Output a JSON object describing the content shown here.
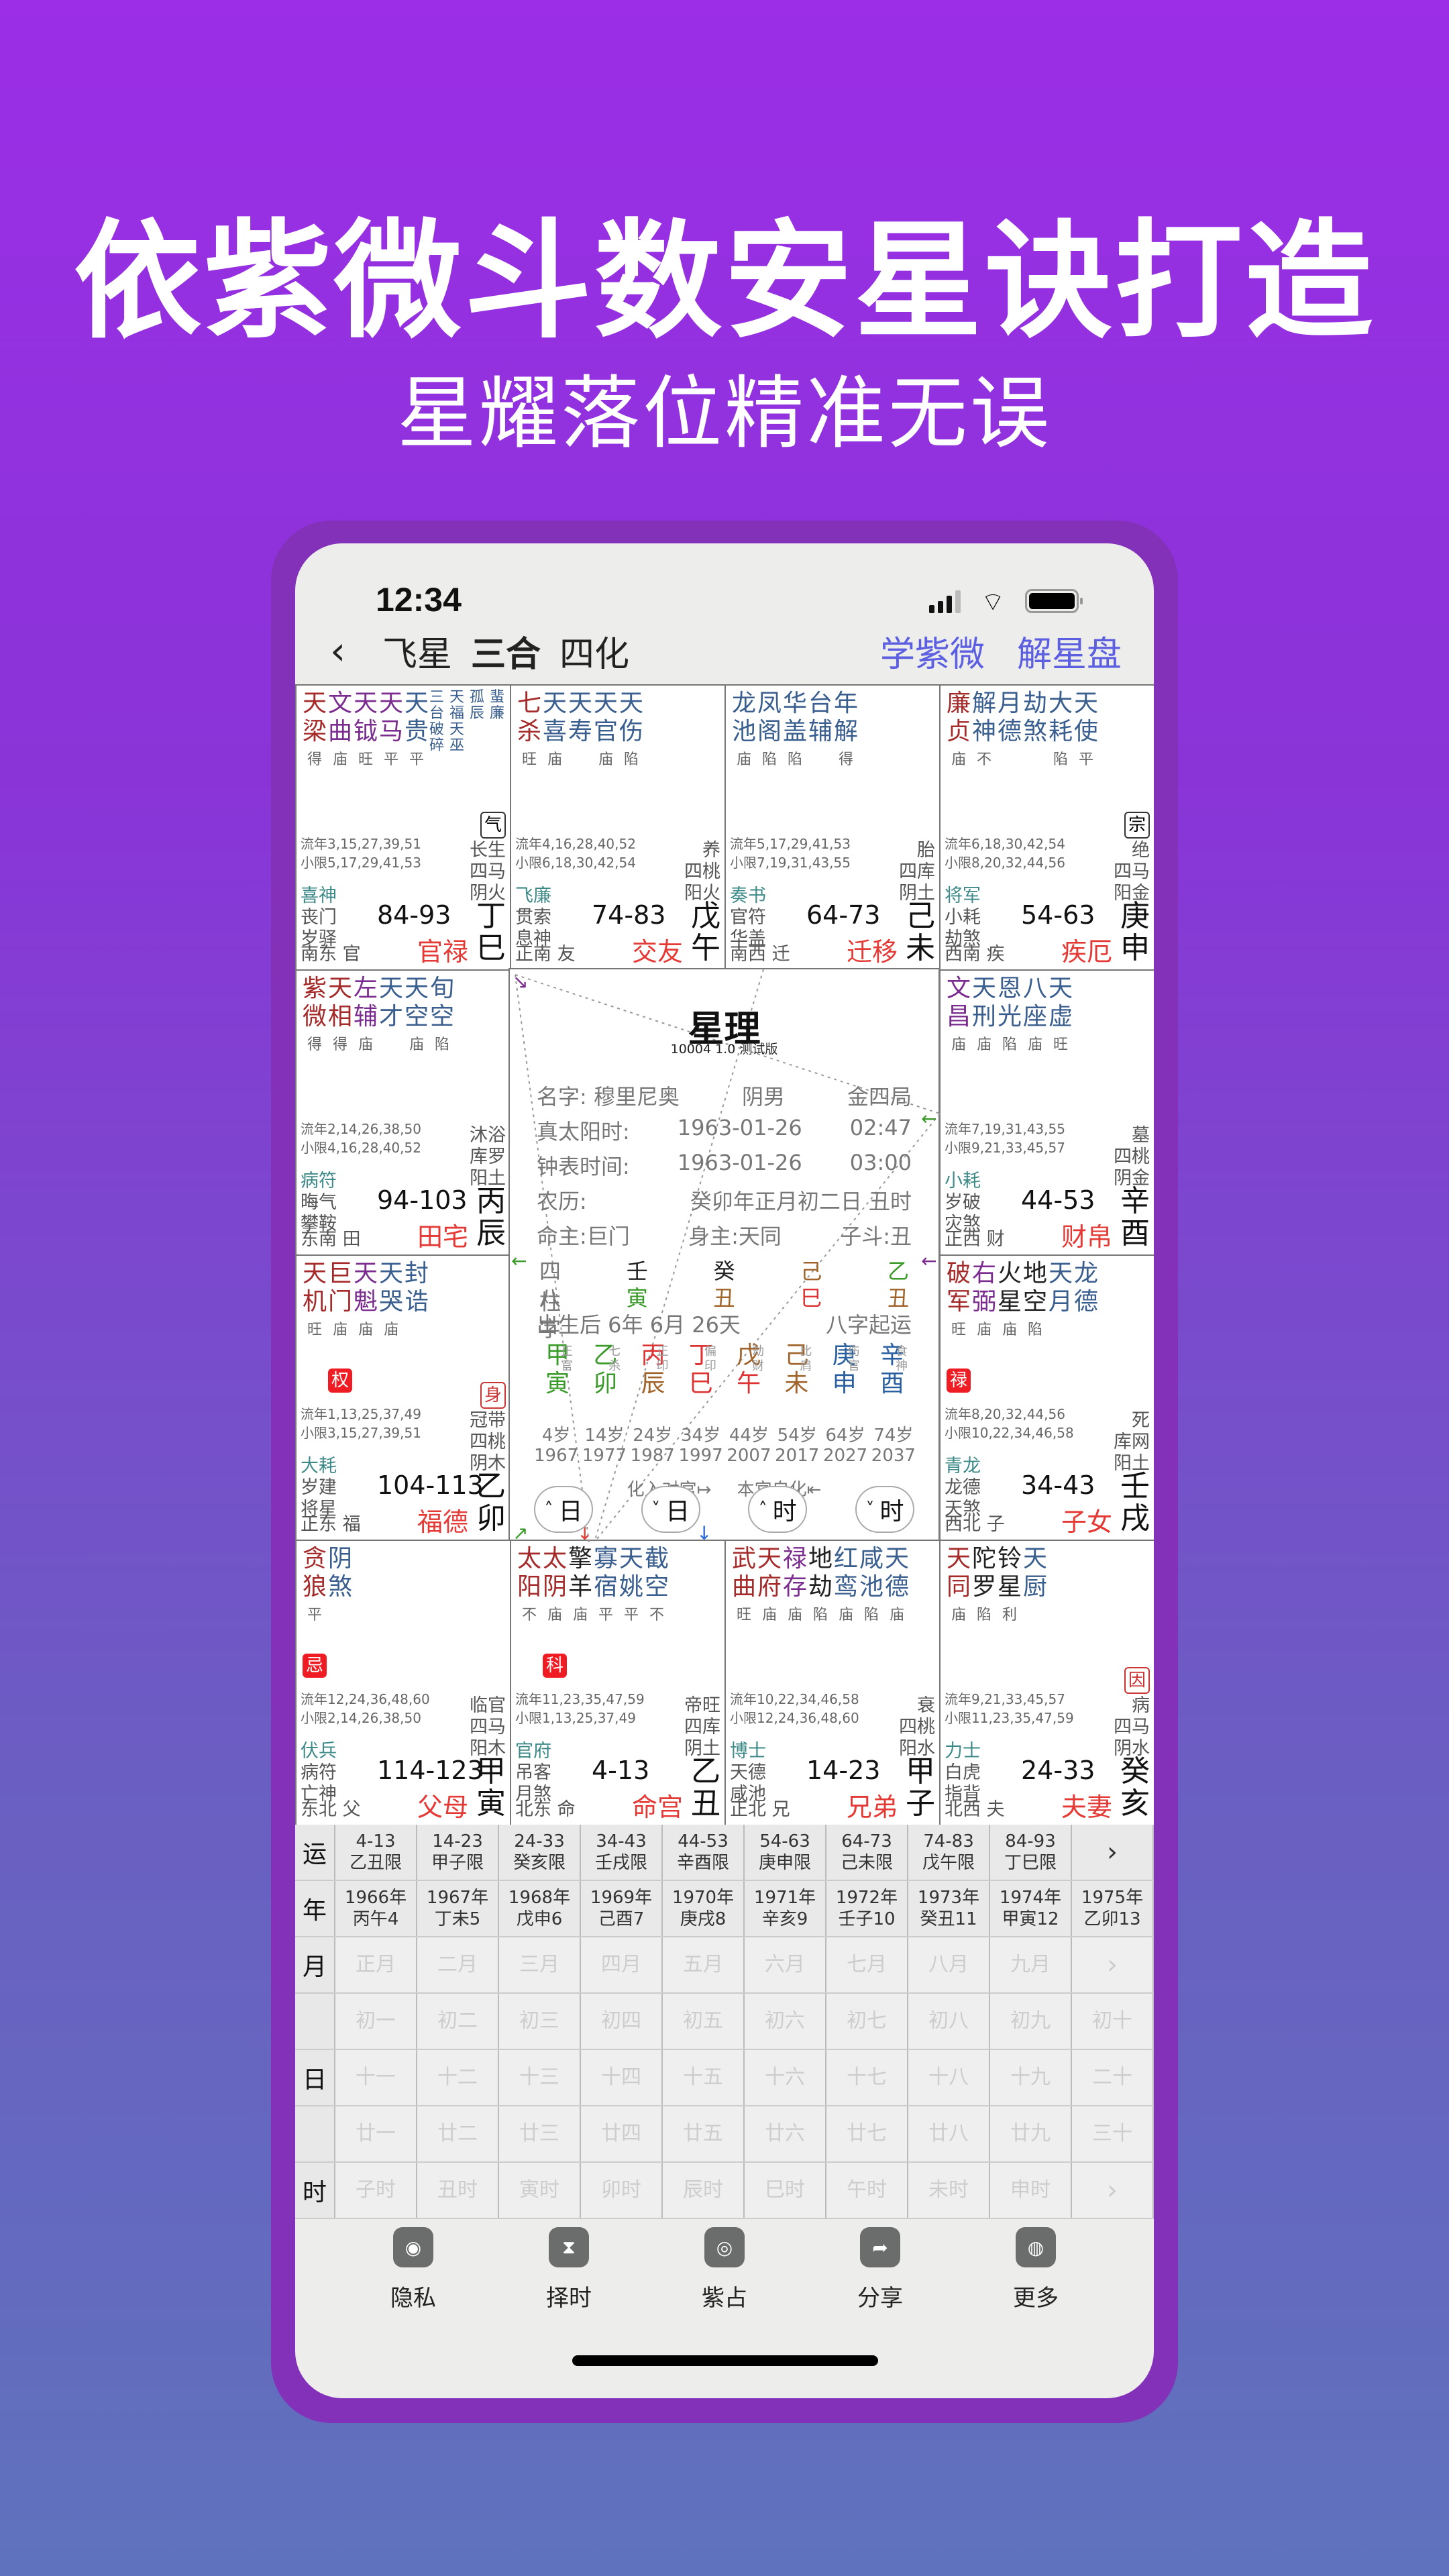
{
  "headline": "依紫微斗数安星诀打造",
  "subline": "星耀落位精准无误",
  "status_bar": {
    "time": "12:34"
  },
  "nav": {
    "back_icon": "‹",
    "tabs": [
      "飞星",
      "三合",
      "四化"
    ],
    "links": [
      "学紫微",
      "解星盘"
    ]
  },
  "palaces": [
    {
      "id": "si",
      "stars": [
        [
          "天梁",
          "main",
          "得"
        ],
        [
          "文曲",
          "aux",
          "庙"
        ],
        [
          "天钺",
          "aux",
          "旺"
        ],
        [
          "天马",
          "aux",
          "平"
        ],
        [
          "天贵",
          "minor",
          "平"
        ]
      ],
      "small_stars": [
        "三台",
        "天福",
        "孤辰",
        "蜚廉",
        "破碎",
        "天巫"
      ],
      "hua": null,
      "tag": "气",
      "ages_year": "流年3,15,27,39,51",
      "ages_minor": "小限5,17,29,41,53",
      "gods": [
        "喜神",
        "丧门",
        "岁驿"
      ],
      "dir": "南东 官",
      "range": "84-93",
      "palace": "官禄",
      "life": [
        "长生",
        "四马",
        "阴火"
      ],
      "stem": "丁",
      "branch": "巳"
    },
    {
      "id": "wu",
      "stars": [
        [
          "七杀",
          "main",
          "旺"
        ],
        [
          "天喜",
          "minor",
          "庙"
        ],
        [
          "天寿",
          "minor",
          ""
        ],
        [
          "天官",
          "minor",
          "庙"
        ],
        [
          "天伤",
          "minor",
          "陷"
        ]
      ],
      "hua": null,
      "tag": null,
      "ages_year": "流年4,16,28,40,52",
      "ages_minor": "小限6,18,30,42,54",
      "gods": [
        "飞廉",
        "贯索",
        "息神"
      ],
      "dir": "正南 友",
      "range": "74-83",
      "palace": "交友",
      "life": [
        "养",
        "四桃",
        "阳火"
      ],
      "stem": "戊",
      "branch": "午"
    },
    {
      "id": "wei",
      "stars": [
        [
          "龙池",
          "minor",
          "庙"
        ],
        [
          "凤阁",
          "minor",
          "陷"
        ],
        [
          "华盖",
          "minor",
          "陷"
        ],
        [
          "台辅",
          "minor",
          ""
        ],
        [
          "年解",
          "minor",
          "得"
        ]
      ],
      "hua": null,
      "tag": null,
      "ages_year": "流年5,17,29,41,53",
      "ages_minor": "小限7,19,31,43,55",
      "gods": [
        "奏书",
        "官符",
        "华盖"
      ],
      "dir": "南西 迁",
      "range": "64-73",
      "palace": "迁移",
      "life": [
        "胎",
        "四库",
        "阴土"
      ],
      "stem": "己",
      "branch": "未"
    },
    {
      "id": "shen",
      "stars": [
        [
          "廉贞",
          "main",
          "庙"
        ],
        [
          "解神",
          "minor",
          "不"
        ],
        [
          "月德",
          "minor",
          ""
        ],
        [
          "劫煞",
          "minor",
          ""
        ],
        [
          "大耗",
          "minor",
          "陷"
        ],
        [
          "天使",
          "minor",
          "平"
        ]
      ],
      "hua": null,
      "tag": "宗",
      "ages_year": "流年6,18,30,42,54",
      "ages_minor": "小限8,20,32,44,56",
      "gods": [
        "将军",
        "小耗",
        "劫煞"
      ],
      "dir": "西南 疾",
      "range": "54-63",
      "palace": "疾厄",
      "life": [
        "绝",
        "四马",
        "阳金"
      ],
      "stem": "庚",
      "branch": "申"
    },
    {
      "id": "chen",
      "stars": [
        [
          "紫微",
          "main",
          "得"
        ],
        [
          "天相",
          "main",
          "得"
        ],
        [
          "左辅",
          "aux",
          "庙"
        ],
        [
          "天才",
          "minor",
          ""
        ],
        [
          "天空",
          "minor",
          "庙"
        ],
        [
          "旬空",
          "minor",
          "陷"
        ]
      ],
      "hua": null,
      "tag": null,
      "ages_year": "流年2,14,26,38,50",
      "ages_minor": "小限4,16,28,40,52",
      "gods": [
        "病符",
        "晦气",
        "攀鞍"
      ],
      "dir": "东南 田",
      "range": "94-103",
      "palace": "田宅",
      "life": [
        "沐浴",
        "库罗",
        "阳土"
      ],
      "stem": "丙",
      "branch": "辰"
    },
    {
      "id": "you",
      "stars": [
        [
          "文昌",
          "aux",
          "庙"
        ],
        [
          "天刑",
          "minor",
          "庙"
        ],
        [
          "恩光",
          "minor",
          "陷"
        ],
        [
          "八座",
          "minor",
          "庙"
        ],
        [
          "天虚",
          "minor",
          "旺"
        ]
      ],
      "hua": null,
      "tag": null,
      "ages_year": "流年7,19,31,43,55",
      "ages_minor": "小限9,21,33,45,57",
      "gods": [
        "小耗",
        "岁破",
        "灾煞"
      ],
      "dir": "正西 财",
      "range": "44-53",
      "palace": "财帛",
      "life": [
        "墓",
        "四桃",
        "阴金"
      ],
      "stem": "辛",
      "branch": "酉"
    },
    {
      "id": "mao",
      "stars": [
        [
          "天机",
          "main",
          "旺"
        ],
        [
          "巨门",
          "main",
          "庙"
        ],
        [
          "天魁",
          "aux",
          "庙"
        ],
        [
          "天哭",
          "minor",
          "庙"
        ],
        [
          "封诰",
          "minor",
          ""
        ]
      ],
      "hua": {
        "label": "权",
        "index": 1
      },
      "tag": "身",
      "tag_red": true,
      "ages_year": "流年1,13,25,37,49",
      "ages_minor": "小限3,15,27,39,51",
      "gods": [
        "大耗",
        "岁建",
        "将星"
      ],
      "dir": "正东 福",
      "range": "104-113",
      "palace": "福德",
      "life": [
        "冠带",
        "四桃",
        "阴木"
      ],
      "stem": "乙",
      "branch": "卯"
    },
    {
      "id": "xu",
      "stars": [
        [
          "破军",
          "main",
          "旺"
        ],
        [
          "右弼",
          "aux",
          "庙"
        ],
        [
          "火星",
          "bad",
          "庙"
        ],
        [
          "地空",
          "bad",
          "陷"
        ],
        [
          "天月",
          "minor",
          ""
        ],
        [
          "龙德",
          "minor",
          ""
        ]
      ],
      "hua": {
        "label": "禄",
        "index": 0
      },
      "tag": null,
      "ages_year": "流年8,20,32,44,56",
      "ages_minor": "小限10,22,34,46,58",
      "gods": [
        "青龙",
        "龙德",
        "天煞"
      ],
      "dir": "西北 子",
      "range": "34-43",
      "palace": "子女",
      "life": [
        "死",
        "库网",
        "阳土"
      ],
      "stem": "壬",
      "branch": "戌"
    },
    {
      "id": "yin",
      "stars": [
        [
          "贪狼",
          "main",
          "平"
        ],
        [
          "阴煞",
          "minor",
          ""
        ]
      ],
      "hua": {
        "label": "忌",
        "index": 0
      },
      "tag": null,
      "ages_year": "流年12,24,36,48,60",
      "ages_minor": "小限2,14,26,38,50",
      "gods": [
        "伏兵",
        "病符",
        "亡神"
      ],
      "dir": "东北 父",
      "range": "114-123",
      "palace": "父母",
      "life": [
        "临官",
        "四马",
        "阳木"
      ],
      "stem": "甲",
      "branch": "寅"
    },
    {
      "id": "chou",
      "stars": [
        [
          "太阳",
          "main",
          "不"
        ],
        [
          "太阴",
          "main",
          "庙"
        ],
        [
          "擎羊",
          "bad",
          "庙"
        ],
        [
          "寡宿",
          "minor",
          "平"
        ],
        [
          "天姚",
          "minor",
          "平"
        ],
        [
          "截空",
          "minor",
          "不"
        ]
      ],
      "hua": {
        "label": "科",
        "index": 1
      },
      "tag": null,
      "ages_year": "流年11,23,35,47,59",
      "ages_minor": "小限1,13,25,37,49",
      "gods": [
        "官府",
        "吊客",
        "月煞"
      ],
      "dir": "北东 命",
      "range": "4-13",
      "palace": "命宫",
      "life": [
        "帝旺",
        "四库",
        "阴土"
      ],
      "stem": "乙",
      "branch": "丑"
    },
    {
      "id": "zi",
      "stars": [
        [
          "武曲",
          "main",
          "旺"
        ],
        [
          "天府",
          "main",
          "庙"
        ],
        [
          "禄存",
          "aux",
          "庙"
        ],
        [
          "地劫",
          "bad",
          "陷"
        ],
        [
          "红鸾",
          "minor",
          "庙"
        ],
        [
          "咸池",
          "minor",
          "陷"
        ],
        [
          "天德",
          "minor",
          "庙"
        ]
      ],
      "hua": null,
      "tag": null,
      "ages_year": "流年10,22,34,46,58",
      "ages_minor": "小限12,24,36,48,60",
      "gods": [
        "博士",
        "天德",
        "咸池"
      ],
      "dir": "正北 兄",
      "range": "14-23",
      "palace": "兄弟",
      "life": [
        "衰",
        "四桃",
        "阳水"
      ],
      "stem": "甲",
      "branch": "子"
    },
    {
      "id": "hai",
      "stars": [
        [
          "天同",
          "main",
          "庙"
        ],
        [
          "陀罗",
          "bad",
          "陷"
        ],
        [
          "铃星",
          "bad",
          "利"
        ],
        [
          "天厨",
          "minor",
          ""
        ]
      ],
      "hua": null,
      "tag": "因",
      "tag_red": true,
      "ages_year": "流年9,21,33,45,57",
      "ages_minor": "小限11,23,35,47,59",
      "gods": [
        "力士",
        "白虎",
        "指背"
      ],
      "dir": "北西 夫",
      "range": "24-33",
      "palace": "夫妻",
      "life": [
        "病",
        "四马",
        "阴水"
      ],
      "stem": "癸",
      "branch": "亥"
    }
  ],
  "center": {
    "title": "星理",
    "version": "10004 1.0 测试版",
    "rows": [
      [
        "名字: 穆里尼奥",
        "阴男",
        "金四局"
      ],
      [
        "真太阳时:",
        "1963-01-26",
        "02:47"
      ],
      [
        "钟表时间:",
        "1963-01-26",
        "03:00"
      ],
      [
        "农历:",
        "癸卯年正月初二日 丑时"
      ],
      [
        "命主:巨门",
        "身主:天同",
        "子斗:丑"
      ]
    ],
    "pillars_label": "四柱",
    "pillars": [
      [
        "壬",
        "#222"
      ],
      [
        "癸",
        "#222"
      ],
      [
        "己",
        "#a0632a"
      ],
      [
        "乙",
        "#3a9a2a"
      ]
    ],
    "bazi_label": "八字",
    "bazi": [
      [
        "寅",
        "#3a9a2a"
      ],
      [
        "丑",
        "#a0632a"
      ],
      [
        "巳",
        "#d33"
      ],
      [
        "丑",
        "#a0632a"
      ]
    ],
    "start_luck": "出生后 6年 6月 26天",
    "start_luck_label": "八字起运",
    "dayun": [
      {
        "stem": "甲",
        "branch": "寅",
        "god": "正官",
        "color": "#3a9a2a",
        "bcolor": "#3a9a2a"
      },
      {
        "stem": "乙",
        "branch": "卯",
        "god": "七杀",
        "color": "#3a9a2a",
        "bcolor": "#3a9a2a"
      },
      {
        "stem": "丙",
        "branch": "辰",
        "god": "正印",
        "color": "#d33",
        "bcolor": "#a0632a"
      },
      {
        "stem": "丁",
        "branch": "巳",
        "god": "偏印",
        "color": "#d33",
        "bcolor": "#d33"
      },
      {
        "stem": "戊",
        "branch": "午",
        "god": "劫财",
        "color": "#a0632a",
        "bcolor": "#d33"
      },
      {
        "stem": "己",
        "branch": "未",
        "god": "比肩",
        "color": "#a0632a",
        "bcolor": "#a0632a"
      },
      {
        "stem": "庚",
        "branch": "申",
        "god": "伤官",
        "color": "#2a5fa0",
        "bcolor": "#2a5fa0"
      },
      {
        "stem": "辛",
        "branch": "酉",
        "god": "食神",
        "color": "#2a5fa0",
        "bcolor": "#2a5fa0"
      }
    ],
    "ages": [
      "4岁",
      "14岁",
      "24岁",
      "34岁",
      "44岁",
      "54岁",
      "64岁",
      "74岁"
    ],
    "years": [
      "1967",
      "1977",
      "1987",
      "1997",
      "2007",
      "2017",
      "2027",
      "2037"
    ],
    "hint_left": "化入对宫↦",
    "hint_right": "本宫自化⇤",
    "buttons": [
      "^ 日",
      "v 日",
      "^ 时",
      "v 时"
    ]
  },
  "luck_table": {
    "yun_label": "运",
    "yun": [
      [
        "4-13",
        "乙丑限"
      ],
      [
        "14-23",
        "甲子限"
      ],
      [
        "24-33",
        "癸亥限"
      ],
      [
        "34-43",
        "壬戌限"
      ],
      [
        "44-53",
        "辛酉限"
      ],
      [
        "54-63",
        "庚申限"
      ],
      [
        "64-73",
        "己未限"
      ],
      [
        "74-83",
        "戊午限"
      ],
      [
        "84-93",
        "丁巳限"
      ]
    ],
    "nian_label": "年",
    "nian": [
      [
        "1966年",
        "丙午4"
      ],
      [
        "1967年",
        "丁未5"
      ],
      [
        "1968年",
        "戊申6"
      ],
      [
        "1969年",
        "己酉7"
      ],
      [
        "1970年",
        "庚戌8"
      ],
      [
        "1971年",
        "辛亥9"
      ],
      [
        "1972年",
        "壬子10"
      ],
      [
        "1973年",
        "癸丑11"
      ],
      [
        "1974年",
        "甲寅12"
      ],
      [
        "1975年",
        "乙卯13"
      ]
    ],
    "yue_label": "月",
    "yue": [
      "正月",
      "二月",
      "三月",
      "四月",
      "五月",
      "六月",
      "七月",
      "八月",
      "九月"
    ],
    "ri_label": "日",
    "ri": [
      [
        "初一",
        "初二",
        "初三",
        "初四",
        "初五",
        "初六",
        "初七",
        "初八",
        "初九",
        "初十"
      ],
      [
        "十一",
        "十二",
        "十三",
        "十四",
        "十五",
        "十六",
        "十七",
        "十八",
        "十九",
        "二十"
      ],
      [
        "廿一",
        "廿二",
        "廿三",
        "廿四",
        "廿五",
        "廿六",
        "廿七",
        "廿八",
        "廿九",
        "三十"
      ]
    ],
    "shi_label": "时",
    "shi": [
      "子时",
      "丑时",
      "寅时",
      "卯时",
      "辰时",
      "巳时",
      "午时",
      "未时",
      "申时"
    ],
    "next_arrow": "›"
  },
  "tabbar": [
    {
      "label": "隐私",
      "icon": "privacy-icon",
      "glyph": "◉"
    },
    {
      "label": "择时",
      "icon": "hourglass-icon",
      "glyph": "⧗"
    },
    {
      "label": "紫占",
      "icon": "divination-icon",
      "glyph": "◎"
    },
    {
      "label": "分享",
      "icon": "share-icon",
      "glyph": "➦"
    },
    {
      "label": "更多",
      "icon": "more-icon",
      "glyph": "◍"
    }
  ],
  "colors": {
    "main": "#a52a2a",
    "aux": "#7b2c8f",
    "minor": "#3a5f8f",
    "bad": "#222222",
    "palace": "#e53935",
    "link": "#5b5fe0",
    "hua": "#ef1c24"
  }
}
